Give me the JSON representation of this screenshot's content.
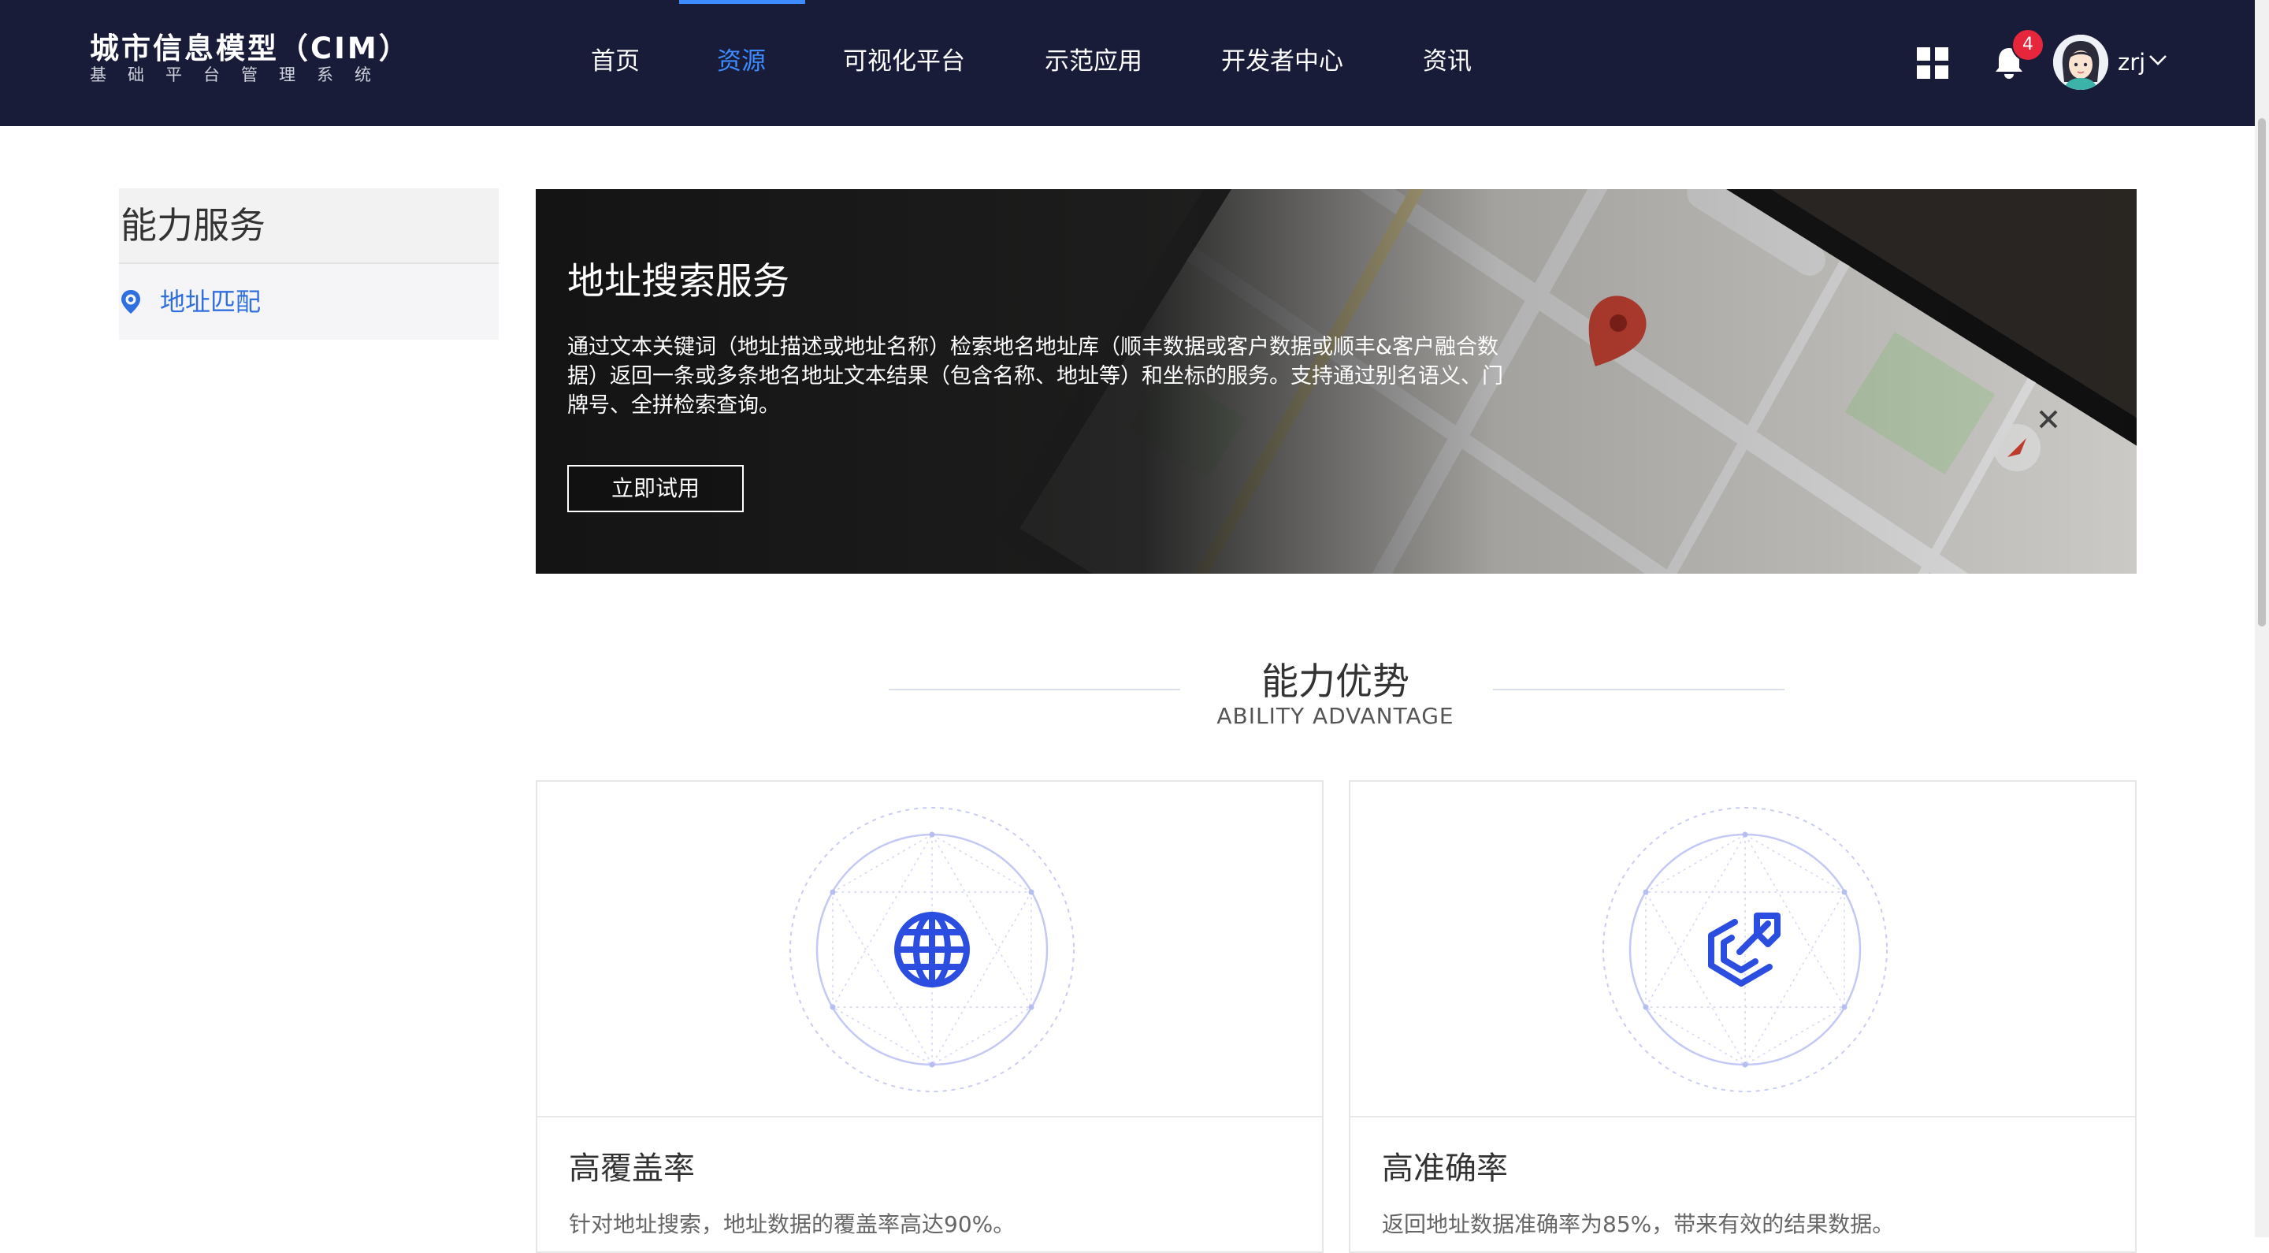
{
  "header": {
    "logo": {
      "title": "城市信息模型（CIM）",
      "subtitle": "基础平台管理系统"
    },
    "nav": [
      {
        "label": "首页",
        "active": false
      },
      {
        "label": "资源",
        "active": true
      },
      {
        "label": "可视化平台",
        "active": false
      },
      {
        "label": "示范应用",
        "active": false
      },
      {
        "label": "开发者中心",
        "active": false
      },
      {
        "label": "资讯",
        "active": false
      }
    ],
    "apps_icon": "grid-apps-icon",
    "notification_icon": "bell-icon",
    "notification_count": "4",
    "username": "zrj"
  },
  "sidebar": {
    "title": "能力服务",
    "items": [
      {
        "label": "地址匹配",
        "icon": "location-pin-icon",
        "active": true
      }
    ]
  },
  "banner": {
    "title": "地址搜索服务",
    "description": "通过文本关键词（地址描述或地址名称）检索地名地址库（顺丰数据或客户数据或顺丰&客户融合数据）返回一条或多条地名地址文本结果（包含名称、地址等）和坐标的服务。支持通过别名语义、门牌号、全拼检索查询。",
    "button": "立即试用"
  },
  "section": {
    "title": "能力优势",
    "subtitle": "ABILITY ADVANTAGE"
  },
  "cards": [
    {
      "title": "高覆盖率",
      "description": "针对地址搜索，地址数据的覆盖率高达90%。",
      "icon": "globe-icon"
    },
    {
      "title": "高准确率",
      "description": "返回地址数据准确率为85%，带来有效的结果数据。",
      "icon": "precision-icon"
    }
  ],
  "colors": {
    "header_bg": "#181c38",
    "accent": "#3d8bff",
    "badge": "#e5263b",
    "icon_blue": "#2b4de0"
  }
}
